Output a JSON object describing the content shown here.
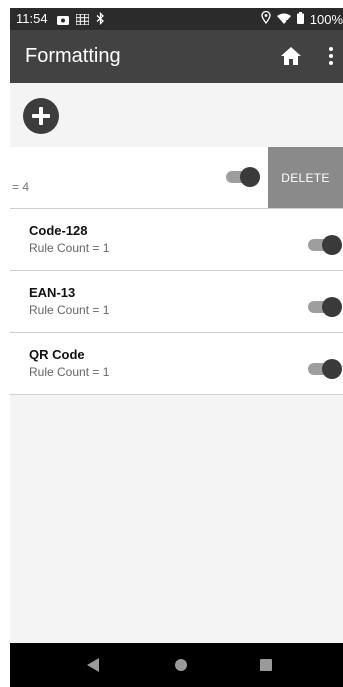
{
  "status_bar": {
    "time": "11:54",
    "battery": "100%",
    "left_icons": [
      "notification-icon",
      "grid-icon",
      "bluetooth-icon"
    ],
    "right_icons": [
      "location-icon",
      "wifi-icon",
      "battery-icon"
    ]
  },
  "app_bar": {
    "title": "Formatting",
    "icons": [
      "home-icon",
      "more-vert-icon"
    ]
  },
  "add_button": {
    "icon": "plus-icon"
  },
  "swiped_row": {
    "text": "= 4",
    "delete_label": "DELETE",
    "toggle_on": true
  },
  "rules": [
    {
      "name": "Code-128",
      "count_text": "Rule Count = 1",
      "enabled": true
    },
    {
      "name": "EAN-13",
      "count_text": "Rule Count = 1",
      "enabled": true
    },
    {
      "name": "QR Code",
      "count_text": "Rule Count = 1",
      "enabled": true
    }
  ],
  "nav_bar": {
    "icons": [
      "back-icon",
      "home-circle-icon",
      "recents-icon"
    ]
  },
  "colors": {
    "app_bar": "#424242",
    "status_bar": "#2b2b2b",
    "background": "#f4f4f4",
    "delete": "#8a8a8a",
    "toggle_thumb": "#3a3a3a",
    "toggle_track": "#9e9e9e"
  }
}
